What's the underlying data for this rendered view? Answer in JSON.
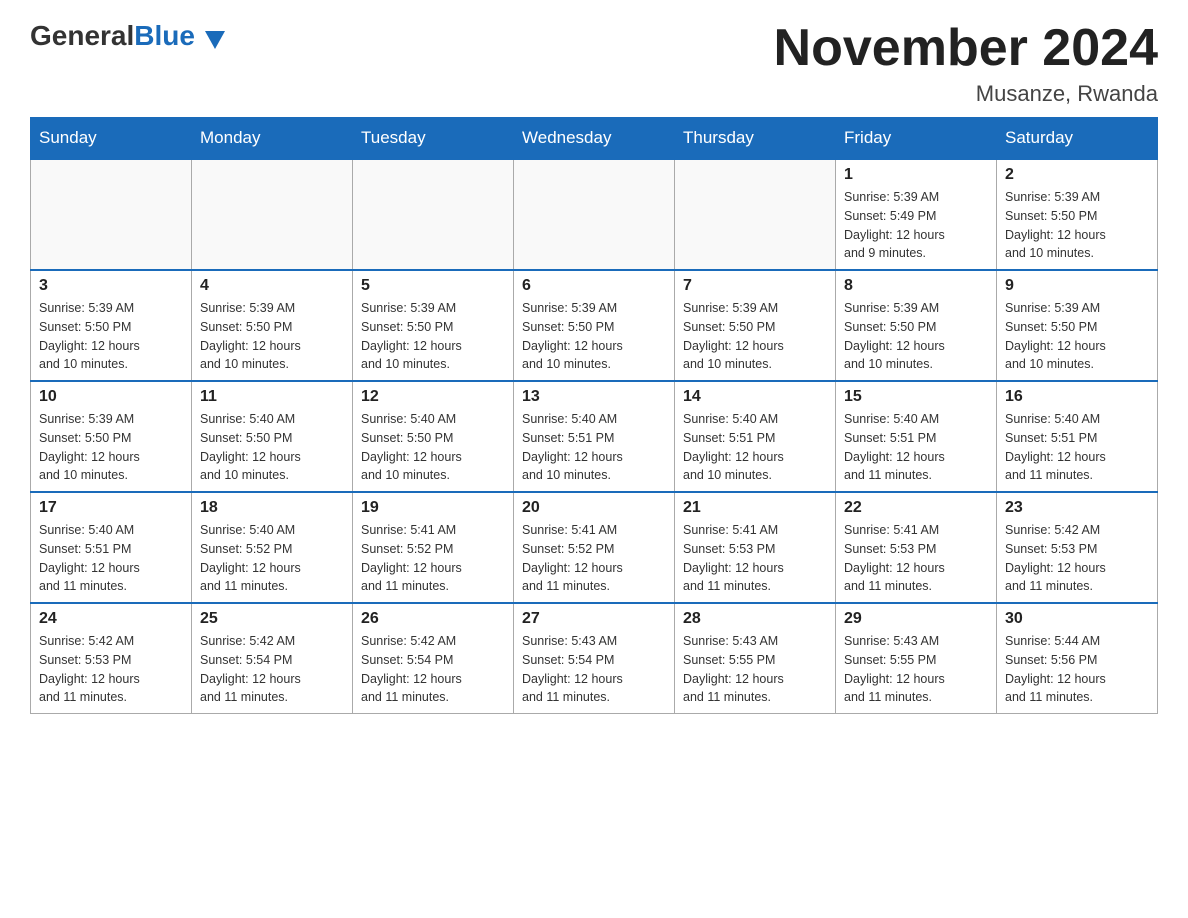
{
  "header": {
    "logo_general": "General",
    "logo_blue": "Blue",
    "month_title": "November 2024",
    "location": "Musanze, Rwanda"
  },
  "days_of_week": [
    "Sunday",
    "Monday",
    "Tuesday",
    "Wednesday",
    "Thursday",
    "Friday",
    "Saturday"
  ],
  "weeks": [
    {
      "days": [
        {
          "number": "",
          "info": ""
        },
        {
          "number": "",
          "info": ""
        },
        {
          "number": "",
          "info": ""
        },
        {
          "number": "",
          "info": ""
        },
        {
          "number": "",
          "info": ""
        },
        {
          "number": "1",
          "info": "Sunrise: 5:39 AM\nSunset: 5:49 PM\nDaylight: 12 hours\nand 9 minutes."
        },
        {
          "number": "2",
          "info": "Sunrise: 5:39 AM\nSunset: 5:50 PM\nDaylight: 12 hours\nand 10 minutes."
        }
      ]
    },
    {
      "days": [
        {
          "number": "3",
          "info": "Sunrise: 5:39 AM\nSunset: 5:50 PM\nDaylight: 12 hours\nand 10 minutes."
        },
        {
          "number": "4",
          "info": "Sunrise: 5:39 AM\nSunset: 5:50 PM\nDaylight: 12 hours\nand 10 minutes."
        },
        {
          "number": "5",
          "info": "Sunrise: 5:39 AM\nSunset: 5:50 PM\nDaylight: 12 hours\nand 10 minutes."
        },
        {
          "number": "6",
          "info": "Sunrise: 5:39 AM\nSunset: 5:50 PM\nDaylight: 12 hours\nand 10 minutes."
        },
        {
          "number": "7",
          "info": "Sunrise: 5:39 AM\nSunset: 5:50 PM\nDaylight: 12 hours\nand 10 minutes."
        },
        {
          "number": "8",
          "info": "Sunrise: 5:39 AM\nSunset: 5:50 PM\nDaylight: 12 hours\nand 10 minutes."
        },
        {
          "number": "9",
          "info": "Sunrise: 5:39 AM\nSunset: 5:50 PM\nDaylight: 12 hours\nand 10 minutes."
        }
      ]
    },
    {
      "days": [
        {
          "number": "10",
          "info": "Sunrise: 5:39 AM\nSunset: 5:50 PM\nDaylight: 12 hours\nand 10 minutes."
        },
        {
          "number": "11",
          "info": "Sunrise: 5:40 AM\nSunset: 5:50 PM\nDaylight: 12 hours\nand 10 minutes."
        },
        {
          "number": "12",
          "info": "Sunrise: 5:40 AM\nSunset: 5:50 PM\nDaylight: 12 hours\nand 10 minutes."
        },
        {
          "number": "13",
          "info": "Sunrise: 5:40 AM\nSunset: 5:51 PM\nDaylight: 12 hours\nand 10 minutes."
        },
        {
          "number": "14",
          "info": "Sunrise: 5:40 AM\nSunset: 5:51 PM\nDaylight: 12 hours\nand 10 minutes."
        },
        {
          "number": "15",
          "info": "Sunrise: 5:40 AM\nSunset: 5:51 PM\nDaylight: 12 hours\nand 11 minutes."
        },
        {
          "number": "16",
          "info": "Sunrise: 5:40 AM\nSunset: 5:51 PM\nDaylight: 12 hours\nand 11 minutes."
        }
      ]
    },
    {
      "days": [
        {
          "number": "17",
          "info": "Sunrise: 5:40 AM\nSunset: 5:51 PM\nDaylight: 12 hours\nand 11 minutes."
        },
        {
          "number": "18",
          "info": "Sunrise: 5:40 AM\nSunset: 5:52 PM\nDaylight: 12 hours\nand 11 minutes."
        },
        {
          "number": "19",
          "info": "Sunrise: 5:41 AM\nSunset: 5:52 PM\nDaylight: 12 hours\nand 11 minutes."
        },
        {
          "number": "20",
          "info": "Sunrise: 5:41 AM\nSunset: 5:52 PM\nDaylight: 12 hours\nand 11 minutes."
        },
        {
          "number": "21",
          "info": "Sunrise: 5:41 AM\nSunset: 5:53 PM\nDaylight: 12 hours\nand 11 minutes."
        },
        {
          "number": "22",
          "info": "Sunrise: 5:41 AM\nSunset: 5:53 PM\nDaylight: 12 hours\nand 11 minutes."
        },
        {
          "number": "23",
          "info": "Sunrise: 5:42 AM\nSunset: 5:53 PM\nDaylight: 12 hours\nand 11 minutes."
        }
      ]
    },
    {
      "days": [
        {
          "number": "24",
          "info": "Sunrise: 5:42 AM\nSunset: 5:53 PM\nDaylight: 12 hours\nand 11 minutes."
        },
        {
          "number": "25",
          "info": "Sunrise: 5:42 AM\nSunset: 5:54 PM\nDaylight: 12 hours\nand 11 minutes."
        },
        {
          "number": "26",
          "info": "Sunrise: 5:42 AM\nSunset: 5:54 PM\nDaylight: 12 hours\nand 11 minutes."
        },
        {
          "number": "27",
          "info": "Sunrise: 5:43 AM\nSunset: 5:54 PM\nDaylight: 12 hours\nand 11 minutes."
        },
        {
          "number": "28",
          "info": "Sunrise: 5:43 AM\nSunset: 5:55 PM\nDaylight: 12 hours\nand 11 minutes."
        },
        {
          "number": "29",
          "info": "Sunrise: 5:43 AM\nSunset: 5:55 PM\nDaylight: 12 hours\nand 11 minutes."
        },
        {
          "number": "30",
          "info": "Sunrise: 5:44 AM\nSunset: 5:56 PM\nDaylight: 12 hours\nand 11 minutes."
        }
      ]
    }
  ]
}
